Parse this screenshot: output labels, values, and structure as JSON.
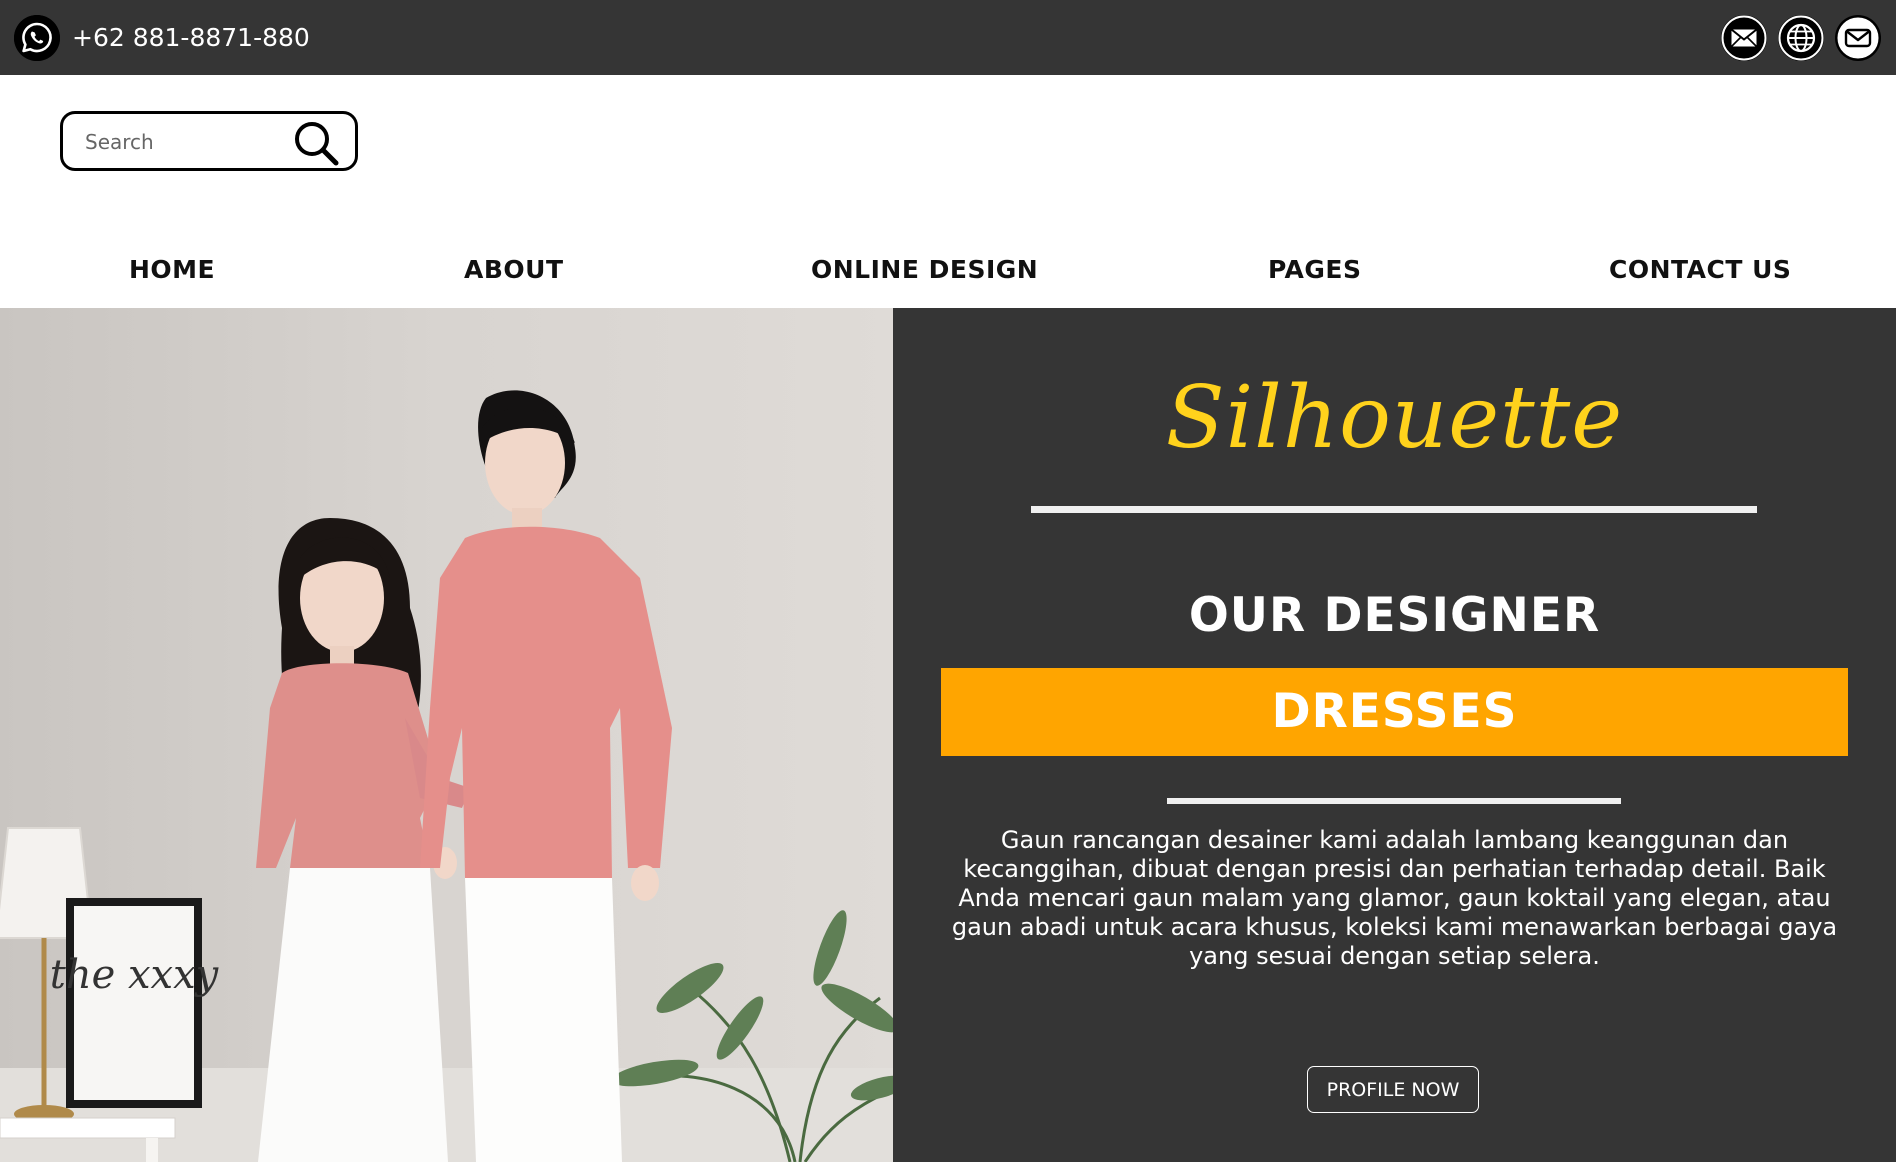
{
  "topbar": {
    "phone": "+62 881-8871-880",
    "left_icon": "whatsapp-icon",
    "right_icons": [
      "mail-icon",
      "globe-icon",
      "email-outline-icon"
    ],
    "background": "#353535"
  },
  "search": {
    "placeholder": "Search",
    "value": "",
    "icon": "search-icon"
  },
  "nav": {
    "items": [
      {
        "label": "HOME"
      },
      {
        "label": "ABOUT"
      },
      {
        "label": "ONLINE DESIGN"
      },
      {
        "label": "PAGES"
      },
      {
        "label": "CONTACT US"
      }
    ]
  },
  "hero": {
    "brand": "Silhouette",
    "heading": "OUR DESIGNER",
    "banner": "DRESSES",
    "description": "Gaun rancangan desainer kami adalah lambang keanggunan dan kecanggihan, dibuat dengan presisi dan perhatian terhadap detail. Baik Anda mencari gaun malam yang glamor, gaun koktail yang elegan, atau gaun abadi untuk acara khusus, koleksi kami menawarkan berbagai gaya yang sesuai dengan setiap selera.",
    "cta_label": "PROFILE NOW",
    "photo_frame_text": "the xxxy",
    "colors": {
      "panel": "#353535",
      "brand": "#ffd21c",
      "banner": "#ffa500",
      "text": "#ffffff"
    }
  }
}
